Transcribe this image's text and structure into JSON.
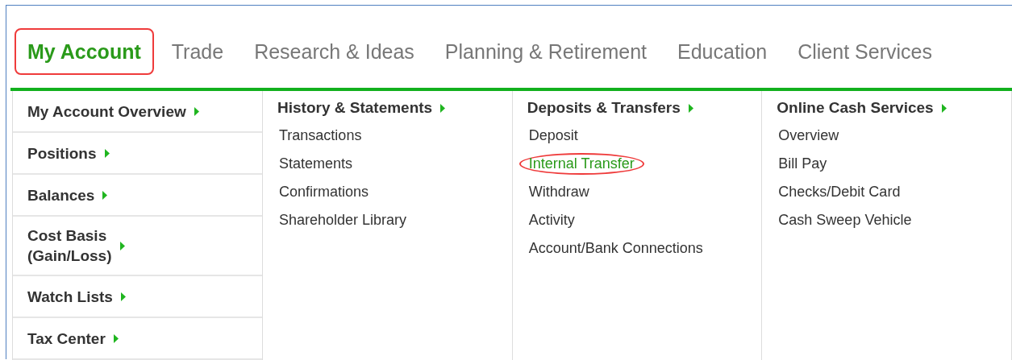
{
  "tabs": [
    {
      "label": "My Account",
      "selected": true,
      "circled": true
    },
    {
      "label": "Trade",
      "selected": false,
      "circled": false
    },
    {
      "label": "Research & Ideas",
      "selected": false,
      "circled": false
    },
    {
      "label": "Planning & Retirement",
      "selected": false,
      "circled": false
    },
    {
      "label": "Education",
      "selected": false,
      "circled": false
    },
    {
      "label": "Client Services",
      "selected": false,
      "circled": false
    }
  ],
  "sidebar": {
    "items": [
      {
        "label": "My Account Overview"
      },
      {
        "label": "Positions"
      },
      {
        "label": "Balances"
      },
      {
        "label": "Cost Basis\n(Gain/Loss)"
      },
      {
        "label": "Watch Lists"
      },
      {
        "label": "Tax Center"
      }
    ]
  },
  "columns": [
    {
      "heading": "History & Statements",
      "links": [
        {
          "label": "Transactions",
          "selected": false,
          "circled": false
        },
        {
          "label": "Statements",
          "selected": false,
          "circled": false
        },
        {
          "label": "Confirmations",
          "selected": false,
          "circled": false
        },
        {
          "label": "Shareholder Library",
          "selected": false,
          "circled": false
        }
      ]
    },
    {
      "heading": "Deposits & Transfers",
      "links": [
        {
          "label": "Deposit",
          "selected": false,
          "circled": false
        },
        {
          "label": "Internal Transfer",
          "selected": true,
          "circled": true
        },
        {
          "label": "Withdraw",
          "selected": false,
          "circled": false
        },
        {
          "label": "Activity",
          "selected": false,
          "circled": false
        },
        {
          "label": "Account/Bank Connections",
          "selected": false,
          "circled": false
        }
      ]
    },
    {
      "heading": "Online Cash Services",
      "links": [
        {
          "label": "Overview",
          "selected": false,
          "circled": false
        },
        {
          "label": "Bill Pay",
          "selected": false,
          "circled": false
        },
        {
          "label": "Checks/Debit Card",
          "selected": false,
          "circled": false
        },
        {
          "label": "Cash Sweep Vehicle",
          "selected": false,
          "circled": false
        }
      ]
    }
  ]
}
